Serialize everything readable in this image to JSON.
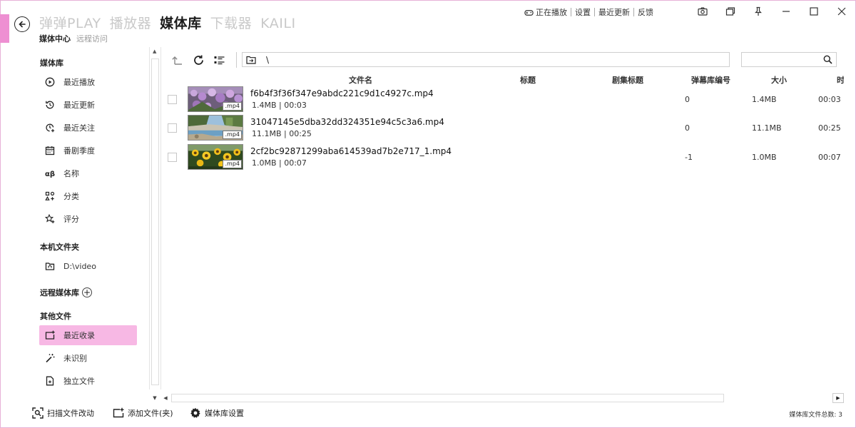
{
  "nav": {
    "tabs": [
      {
        "label": "弹弹PLAY"
      },
      {
        "label": "播放器"
      },
      {
        "label": "媒体库"
      },
      {
        "label": "下载器"
      },
      {
        "label": "KAILI"
      }
    ],
    "sub": {
      "media_center": "媒体中心",
      "remote_access": "远程访问"
    }
  },
  "top_links": {
    "now_playing": "正在播放",
    "settings": "设置",
    "recent_updates": "最近更新",
    "feedback": "反馈"
  },
  "sidebar": {
    "section_library": "媒体库",
    "library_items": [
      {
        "label": "最近播放"
      },
      {
        "label": "最近更新"
      },
      {
        "label": "最近关注"
      },
      {
        "label": "番剧季度"
      },
      {
        "label": "名称"
      },
      {
        "label": "分类"
      },
      {
        "label": "评分"
      }
    ],
    "section_local": "本机文件夹",
    "local_folder": "D:\\video",
    "section_remote": "远程媒体库",
    "section_other": "其他文件",
    "other_items": [
      {
        "label": "最近收录"
      },
      {
        "label": "未识别"
      },
      {
        "label": "独立文件"
      }
    ]
  },
  "toolbar": {
    "path": "\\",
    "search_placeholder": ""
  },
  "table": {
    "columns": {
      "filename": "文件名",
      "title": "标题",
      "episode_title": "剧集标题",
      "danmaku_id": "弹幕库编号",
      "size": "大小",
      "duration": "时"
    },
    "rows": [
      {
        "name": "f6b4f3f36f347e9abdc221c9d1c4927c.mp4",
        "meta": "1.4MB | 00:03",
        "ext": ".mp4",
        "danmaku_id": "0",
        "size": "1.4MB",
        "duration": "00:03",
        "thumb": "lavender"
      },
      {
        "name": "31047145e5dba32dd324351e94c5c3a6.mp4",
        "meta": "11.1MB | 00:25",
        "ext": ".mp4",
        "danmaku_id": "0",
        "size": "11.1MB",
        "duration": "00:25",
        "thumb": "river"
      },
      {
        "name": "2cf2bc92871299aba614539ad7b2e717_1.mp4",
        "meta": "1.0MB | 00:07",
        "ext": ".mp4",
        "danmaku_id": "-1",
        "size": "1.0MB",
        "duration": "00:07",
        "thumb": "sunflowers"
      }
    ]
  },
  "bottom": {
    "scan": "扫描文件改动",
    "add": "添加文件(夹)",
    "library_settings": "媒体库设置",
    "count": "媒体库文件总数: 3"
  },
  "colors": {
    "accent": "#ee8fd2",
    "selected": "#f7b8e4"
  }
}
